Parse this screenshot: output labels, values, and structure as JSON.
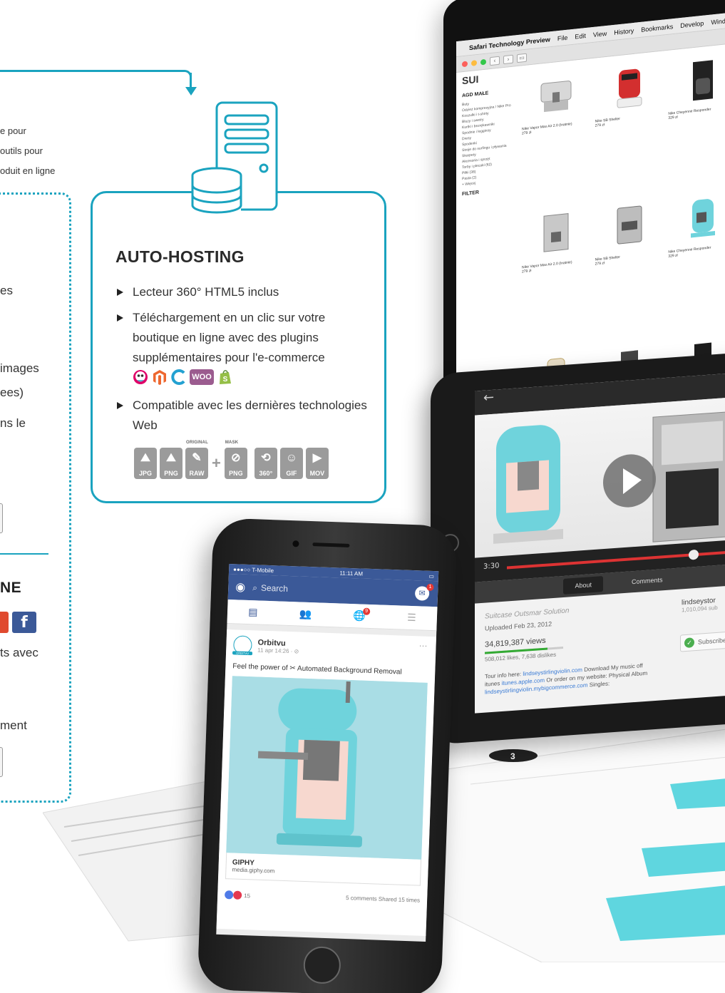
{
  "left_panel": {
    "lines": [
      "e pour",
      "outils pour",
      "oduit en ligne",
      "es",
      "images",
      "ees)",
      "ns le",
      "ts avec",
      "ment"
    ],
    "section_title": "NE",
    "social_fb": "f"
  },
  "card": {
    "title": "AUTO-HOSTING",
    "bullets": [
      {
        "text": "Lecteur 360° HTML5 inclus"
      },
      {
        "text": "Téléchargement en un clic sur votre boutique en ligne avec des plugins supplémentaires pour l'e-commerce"
      },
      {
        "text": "Compatible avec les dernières technologies Web"
      }
    ],
    "plugins": [
      "prestashop-icon",
      "magento-icon",
      "opencart-icon",
      "WOO",
      "shopify-icon"
    ],
    "formats": [
      {
        "label": "JPG",
        "tag": ""
      },
      {
        "label": "PNG",
        "tag": ""
      },
      {
        "label": "RAW",
        "tag": "ORIGINAL"
      },
      {
        "label": "PNG",
        "tag": "MASK"
      },
      {
        "label": "360°",
        "tag": ""
      },
      {
        "label": "GIF",
        "tag": ""
      },
      {
        "label": "MOV",
        "tag": ""
      }
    ],
    "accent": "#1aa3bf"
  },
  "imac": {
    "menu": [
      "Safari Technology Preview",
      "File",
      "Edit",
      "View",
      "History",
      "Bookmarks",
      "Develop",
      "Window"
    ],
    "shop_logo": "SUI",
    "sidebar_head": "AGD MAŁE",
    "filter_head": "FILTER",
    "sidebar_items": [
      "Buty",
      "Odzież kompresyjna / Nike Pro",
      "Koszulki i t-shirty",
      "Bluzy i swetry",
      "Kurtki i bezrękawniki",
      "Spodnie i legginsy",
      "Dresy",
      "Spodenki",
      "Stroje do surfingu i pływania",
      "Skarpety",
      "Akcesoria i sprzęt",
      "Torby i plecaki (62)",
      "Piłki (38)",
      "Pasta (2)",
      "+ Więcej"
    ],
    "products": [
      {
        "name": "Nike Vapor Max Air 2.0 (Inatnie)",
        "price": "279 zł"
      },
      {
        "name": "Nike SB Shelter",
        "price": "279 zł"
      },
      {
        "name": "Nike Cheyenne Responder",
        "price": "329 zł"
      },
      {
        "name": "Nike Vapor Max Air 2.0 (Inatnie)",
        "price": "279 zł"
      },
      {
        "name": "Nike SB Shelter",
        "price": "279 zł"
      },
      {
        "name": "Nike Cheyenne Responder",
        "price": "329 zł"
      },
      {
        "name": "",
        "price": ""
      },
      {
        "name": "",
        "price": ""
      },
      {
        "name": "",
        "price": ""
      }
    ]
  },
  "tablet": {
    "time": "3:30",
    "tabs": [
      "About",
      "Comments"
    ],
    "video_title": "Suitcase Outsmar Solution",
    "uploaded": "Uploaded Feb 23, 2012",
    "views": "34,819,387 views",
    "likes": "508,012 likes, 7,638 dislikes",
    "desc_plain_1": "Tour info here:",
    "desc_link_1": "lindseystirlingviolin.com",
    "desc_plain_2": "Download My music off itunes",
    "desc_link_2": "itunes.apple.com",
    "desc_plain_3": "Or order on my website: Physical Album",
    "desc_link_3": "lindseystirlingviolin.mybigcommerce.com",
    "desc_plain_4": "Singles:",
    "channel": "lindseystor",
    "subs": "1,010,094 sub",
    "subscribed": "Subscribed"
  },
  "phone": {
    "carrier": "●●●○○ T-Mobile",
    "time": "11:11 AM",
    "search": "Search",
    "messenger_badge": "1",
    "notif_badge": "9",
    "post_author": "Orbitvu",
    "post_avatar_label": "ORBITVU",
    "post_time": "11 apr 14:26 · ⊘",
    "post_text": "Feel the power of ✂ Automated Background Removal",
    "link_title": "GIPHY",
    "link_url": "media.giphy.com",
    "reactions": "15",
    "stats": "5 comments  Shared 15 times"
  }
}
